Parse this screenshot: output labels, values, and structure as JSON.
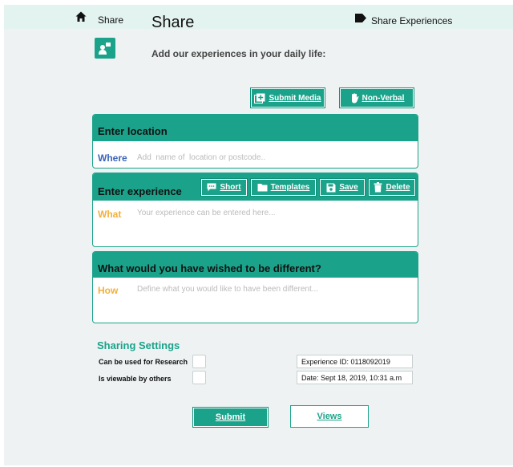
{
  "header": {
    "home_label": "Share",
    "title": "Share",
    "share_experiences_label": "Share Experiences"
  },
  "intro": {
    "subtitle": "Add our experiences in your daily life:"
  },
  "media_buttons": {
    "submit_media": "Submit Media",
    "non_verbal": "Non-Verbal"
  },
  "location_panel": {
    "heading": "Enter location",
    "field_label": "Where",
    "placeholder": "Add  name of  location or postcode.."
  },
  "experience_panel": {
    "heading": "Enter experience",
    "toolbar": {
      "short": "Short",
      "templates": "Templates",
      "save": "Save",
      "delete": "Delete"
    },
    "field_label": "What",
    "placeholder": "Your experience can be entered here..."
  },
  "wish_panel": {
    "heading": "What would you have wished to be different?",
    "field_label": "How",
    "placeholder": "Define what you would like to have been different..."
  },
  "sharing_settings": {
    "title": "Sharing Settings",
    "research_label": "Can be used for Research",
    "research_checked": false,
    "viewable_label": "Is viewable by others",
    "viewable_checked": false,
    "experience_id": "Experience ID: 0118092019",
    "date": "Date: Sept 18, 2019, 10:31 a.m"
  },
  "actions": {
    "submit": "Submit",
    "views": "Views"
  },
  "colors": {
    "accent": "#1aa38a",
    "where_label": "#3a64b8",
    "what_label": "#f2b03a",
    "how_label": "#f2b03a",
    "background": "#eef2f3"
  },
  "icons": {
    "home": "home-icon",
    "share_experiences": "tag-icon",
    "app": "share-app-icon",
    "submit_media": "add-media-icon",
    "non_verbal": "hand-icon",
    "short": "chat-icon",
    "templates": "folder-icon",
    "save": "floppy-disk-icon",
    "delete": "trash-icon"
  }
}
